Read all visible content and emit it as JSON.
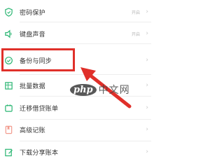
{
  "menu": {
    "items": [
      {
        "label": "密码保护",
        "value": "开启",
        "icon": "shield-icon"
      },
      {
        "label": "键盘声音",
        "value": "开启",
        "icon": "speaker-icon"
      },
      {
        "label": "备份与同步",
        "value": "",
        "icon": "cloud-sync-icon"
      },
      {
        "label": "批量数据",
        "value": "",
        "icon": "spreadsheet-icon"
      },
      {
        "label": "迁移借贷账单",
        "value": "",
        "icon": "wallet-icon"
      },
      {
        "label": "高级记账",
        "value": "",
        "icon": "bookmark-icon"
      },
      {
        "label": "下载分享账本",
        "value": "",
        "icon": "pencil-edit-icon"
      }
    ]
  },
  "watermark": {
    "logo": "php",
    "text": "中文网"
  },
  "colors": {
    "accent": "#2bb673",
    "highlight": "#e0302a"
  }
}
